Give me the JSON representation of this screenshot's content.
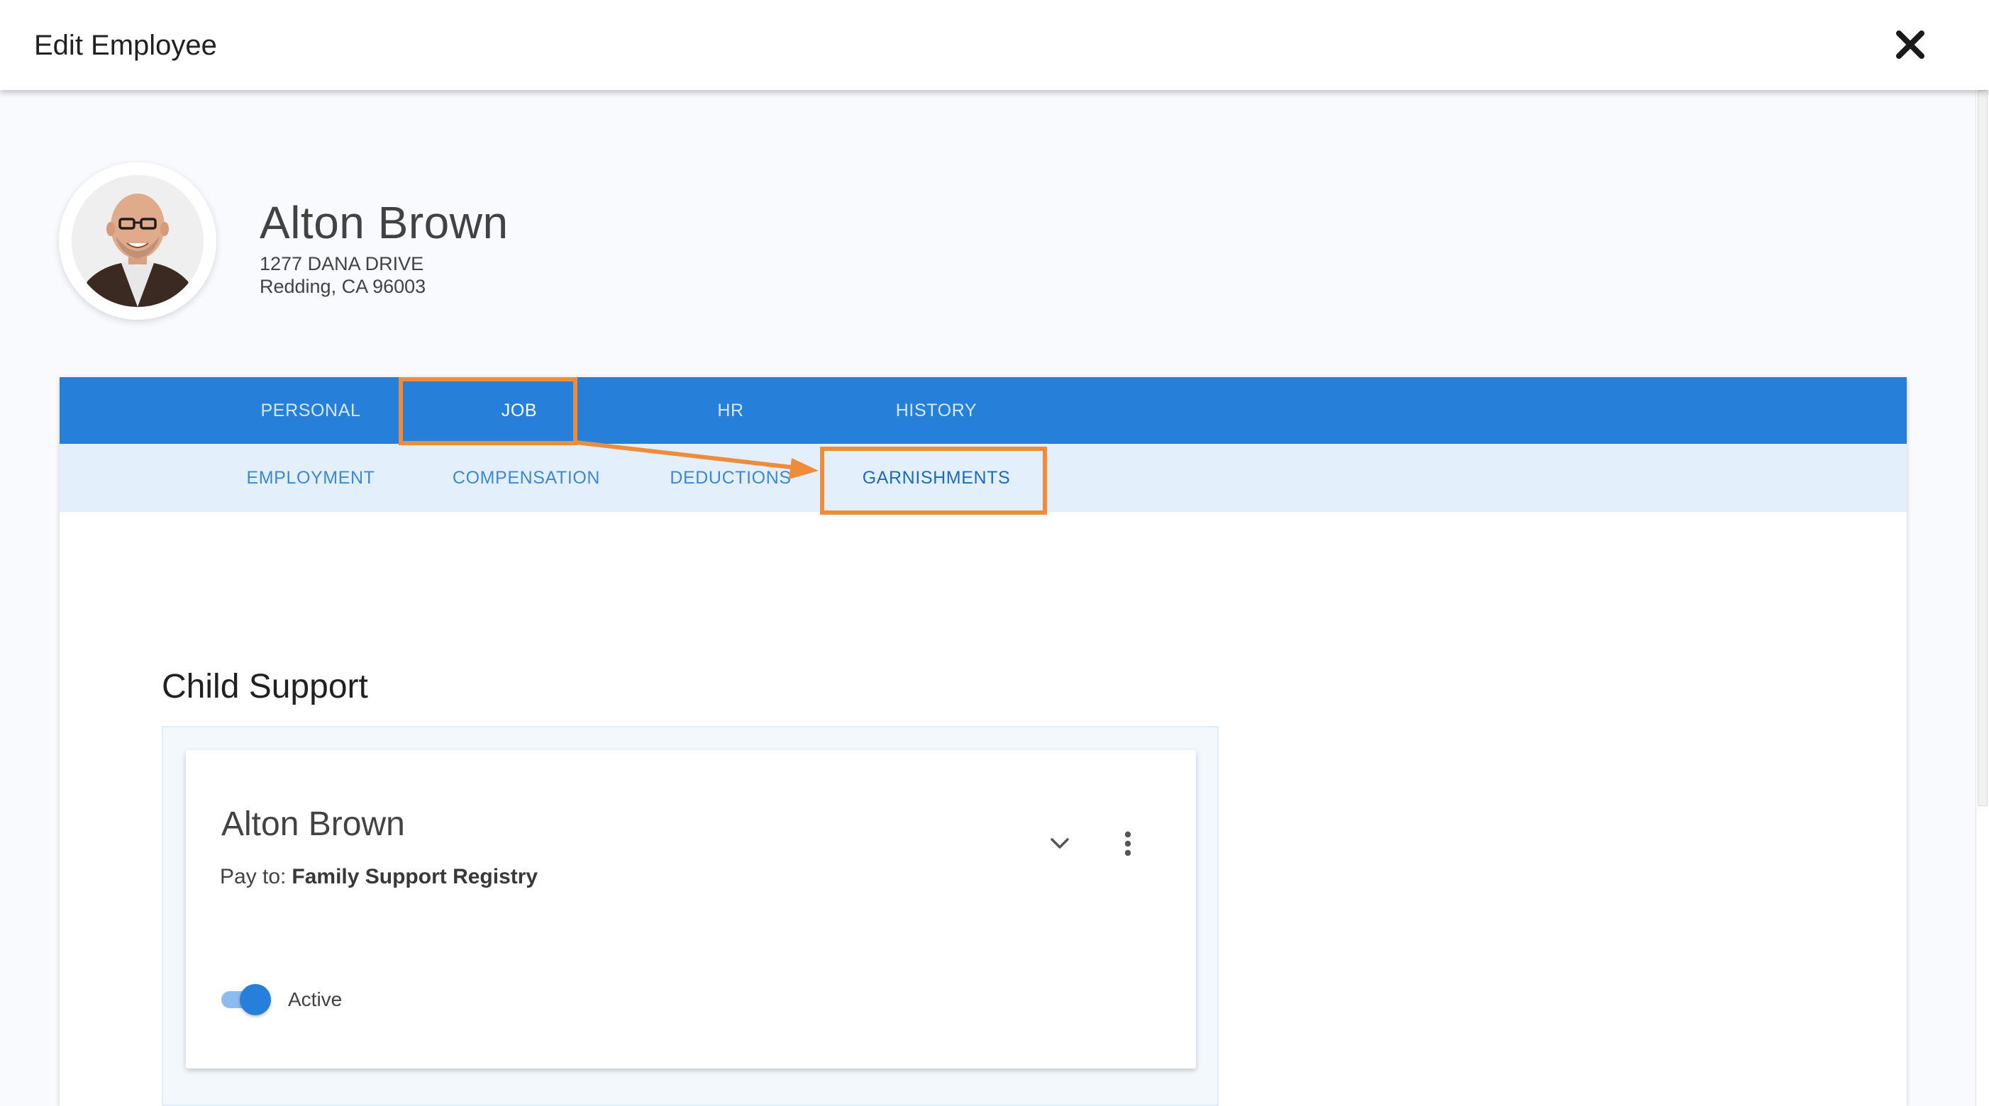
{
  "header": {
    "title": "Edit Employee",
    "close_icon": "close-icon"
  },
  "profile": {
    "name": "Alton Brown",
    "address_line1": "1277 DANA DRIVE",
    "address_line2": "Redding, CA 96003"
  },
  "tabs": {
    "primary": [
      {
        "label": "PERSONAL",
        "active": false
      },
      {
        "label": "JOB",
        "active": true
      },
      {
        "label": "HR",
        "active": false
      },
      {
        "label": "HISTORY",
        "active": false
      }
    ],
    "secondary": [
      {
        "label": "EMPLOYMENT",
        "active": false
      },
      {
        "label": "COMPENSATION",
        "active": false
      },
      {
        "label": "DEDUCTIONS",
        "active": false
      },
      {
        "label": "GARNISHMENTS",
        "active": true
      }
    ]
  },
  "section": {
    "title": "Child Support"
  },
  "card": {
    "name": "Alton Brown",
    "payto_label": "Pay to:",
    "payto_value": "Family Support Registry",
    "toggle_label": "Active",
    "toggle_on": true
  },
  "colors": {
    "primary_blue": "#2680d9",
    "secondary_bg": "#e3f0fc",
    "annotation_orange": "#ef8c3a"
  }
}
